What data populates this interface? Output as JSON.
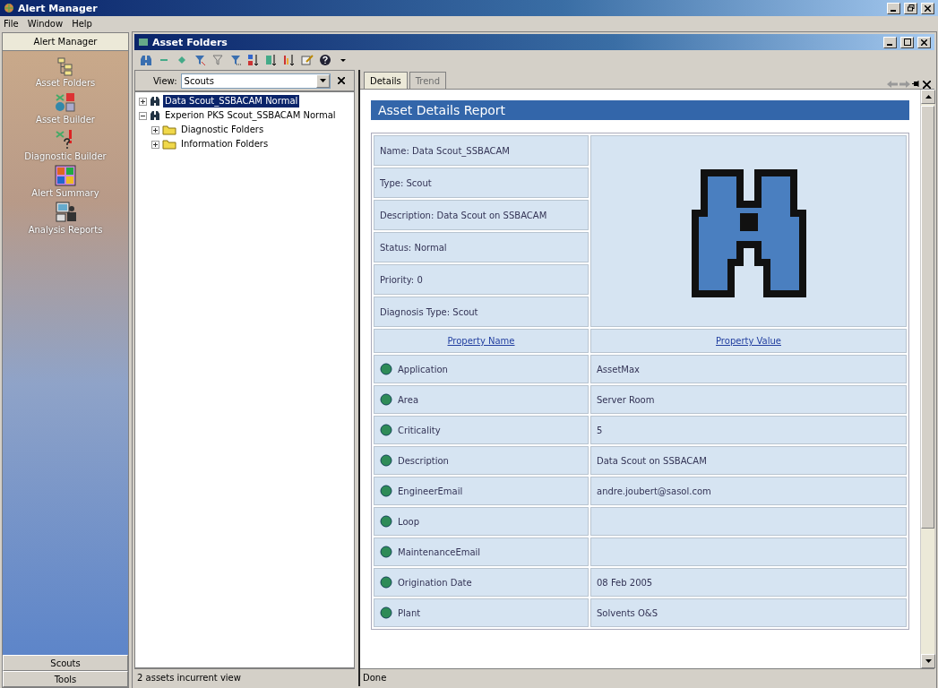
{
  "window": {
    "title": "Alert Manager"
  },
  "menu": [
    "File",
    "Window",
    "Help"
  ],
  "sidebar": {
    "title": "Alert Manager",
    "items": [
      {
        "label": "Asset Folders",
        "kind": "folders"
      },
      {
        "label": "Asset Builder",
        "kind": "builder"
      },
      {
        "label": "Diagnostic Builder",
        "kind": "diagnostic"
      },
      {
        "label": "Alert Summary",
        "kind": "summary"
      },
      {
        "label": "Analysis Reports",
        "kind": "reports"
      }
    ],
    "bottom_buttons": [
      "Scouts",
      "Tools"
    ]
  },
  "child_window": {
    "title": "Asset Folders"
  },
  "view": {
    "label": "View:",
    "value": "Scouts"
  },
  "tree": [
    {
      "label": "Data Scout_SSBACAM Normal",
      "kind": "scout",
      "selected": true,
      "expanded": false
    },
    {
      "label": "Experion PKS Scout_SSBACAM Normal",
      "kind": "scout",
      "selected": false,
      "expanded": true,
      "children": [
        {
          "label": "Diagnostic Folders",
          "kind": "folder",
          "selected": false,
          "expanded": false
        },
        {
          "label": "Information Folders",
          "kind": "folder",
          "selected": false,
          "expanded": false
        }
      ]
    }
  ],
  "left_status": "2 assets incurrent view",
  "tabs": [
    {
      "label": "Details",
      "selected": true
    },
    {
      "label": "Trend",
      "selected": false
    }
  ],
  "report": {
    "title": "Asset Details Report",
    "details": [
      "Name: Data Scout_SSBACAM",
      "Type: Scout",
      "Description: Data Scout on SSBACAM",
      "Status:  Normal",
      "Priority: 0",
      "Diagnosis Type: Scout"
    ],
    "columns": [
      "Property Name",
      "Property Value"
    ],
    "rows": [
      {
        "name": "Application",
        "value": "AssetMax"
      },
      {
        "name": "Area",
        "value": "Server Room"
      },
      {
        "name": "Criticality",
        "value": "5"
      },
      {
        "name": "Description",
        "value": "Data Scout on SSBACAM"
      },
      {
        "name": "EngineerEmail",
        "value": "andre.joubert@sasol.com"
      },
      {
        "name": "Loop",
        "value": ""
      },
      {
        "name": "MaintenanceEmail",
        "value": ""
      },
      {
        "name": "Origination Date",
        "value": "08 Feb 2005"
      },
      {
        "name": "Plant",
        "value": "Solvents O&S"
      }
    ]
  },
  "right_status": "Done"
}
